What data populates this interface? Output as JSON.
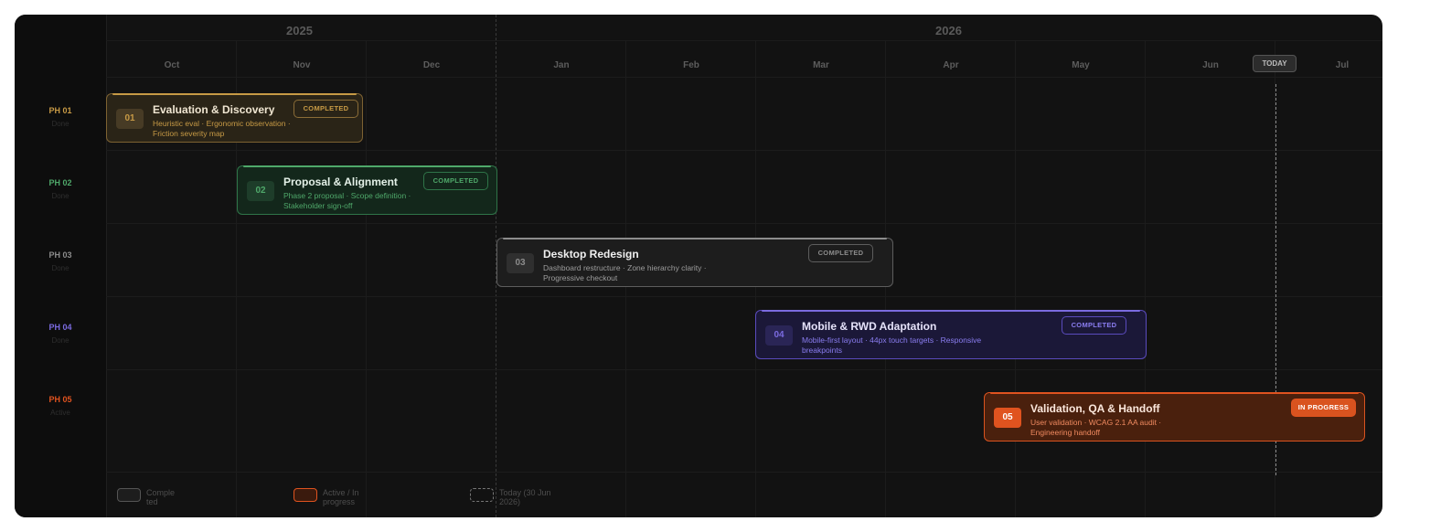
{
  "years": [
    "2025",
    "2026"
  ],
  "months": [
    "Oct",
    "Nov",
    "Dec",
    "Jan",
    "Feb",
    "Mar",
    "Apr",
    "May",
    "Jun",
    "Jul"
  ],
  "today": {
    "label": "TODAY",
    "legend": "Today (30 Jun 2026)"
  },
  "phases": [
    {
      "code": "PH 01",
      "state": "Done",
      "num": "01",
      "title": "Evaluation & Discovery",
      "desc": "Heuristic eval · Ergonomic observation · Friction severity map",
      "status": "COMPLETED",
      "color": "#c79a45"
    },
    {
      "code": "PH 02",
      "state": "Done",
      "num": "02",
      "title": "Proposal & Alignment",
      "desc": "Phase 2 proposal · Scope definition · Stakeholder sign-off",
      "status": "COMPLETED",
      "color": "#4fa86a"
    },
    {
      "code": "PH 03",
      "state": "Done",
      "num": "03",
      "title": "Desktop Redesign",
      "desc": "Dashboard restructure · Zone hierarchy clarity · Progressive checkout",
      "status": "COMPLETED",
      "color": "#8c8c8c"
    },
    {
      "code": "PH 04",
      "state": "Done",
      "num": "04",
      "title": "Mobile & RWD Adaptation",
      "desc": "Mobile-first layout · 44px touch targets · Responsive breakpoints",
      "status": "COMPLETED",
      "color": "#7b6be0"
    },
    {
      "code": "PH 05",
      "state": "Active",
      "num": "05",
      "title": "Validation, QA & Handoff",
      "desc": "User validation · WCAG 2.1 AA audit · Engineering handoff",
      "status": "IN PROGRESS",
      "color": "#e0531f"
    }
  ],
  "legend": {
    "completed": "Comple ted",
    "active": "Active / In progress"
  }
}
